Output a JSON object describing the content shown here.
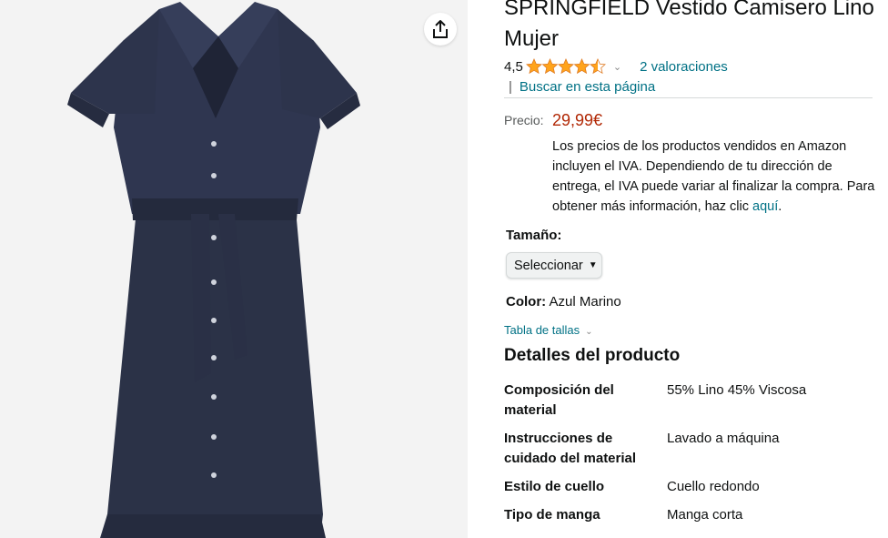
{
  "product": {
    "title": "SPRINGFIELD Vestido Camisero Lino Mujer",
    "rating_value": "4,5",
    "rating_count_label": "2 valoraciones",
    "search_page_label": "Buscar en esta página",
    "price_label": "Precio:",
    "price": "29,99€",
    "tax_note": "Los precios de los productos vendidos en Amazon incluyen el IVA. Dependiendo de tu dirección de entrega, el IVA puede variar al finalizar la compra. Para obtener más información, haz clic",
    "tax_link": "aquí",
    "size_label": "Tamaño:",
    "size_select_value": "Seleccionar",
    "color_label": "Color:",
    "color_value": "Azul Marino",
    "size_chart_link": "Tabla de tallas",
    "details_heading": "Detalles del producto"
  },
  "specs": [
    {
      "key": "Composición del material",
      "value": "55% Lino 45% Viscosa"
    },
    {
      "key": "Instrucciones de cuidado del material",
      "value": "Lavado a máquina"
    },
    {
      "key": "Estilo de cuello",
      "value": "Cuello redondo"
    },
    {
      "key": "Tipo de manga",
      "value": "Manga corta"
    }
  ],
  "icons": {
    "share": "share-icon",
    "star": "star-icon",
    "chevron": "chevron-down-icon"
  },
  "colors": {
    "price": "#b12704",
    "link": "#007185",
    "star": "#ffa41c",
    "dress": "#2b3247"
  }
}
